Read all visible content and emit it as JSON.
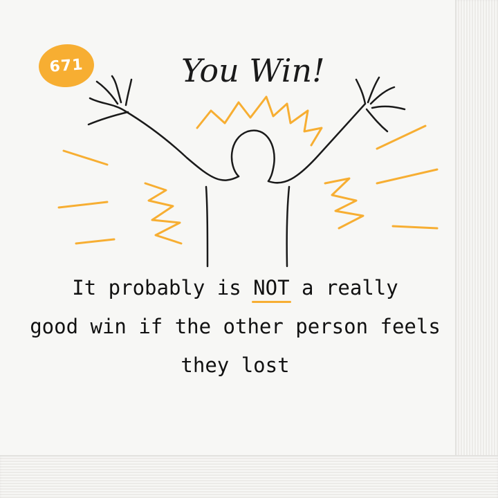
{
  "badge": {
    "number": "671"
  },
  "headline": {
    "text": "You Win!"
  },
  "caption": {
    "line1_start": "It probably is",
    "line1_emph": "NOT",
    "line1_end": "a really",
    "line2": "good win if the other person feels",
    "line3": "they lost"
  },
  "colors": {
    "accent": "#f7ae32",
    "ink": "#1a1a1a",
    "paper": "#f7f7f5"
  },
  "icons": {
    "figure": "cheering-person-icon",
    "burst": "burst-lines-icon"
  }
}
